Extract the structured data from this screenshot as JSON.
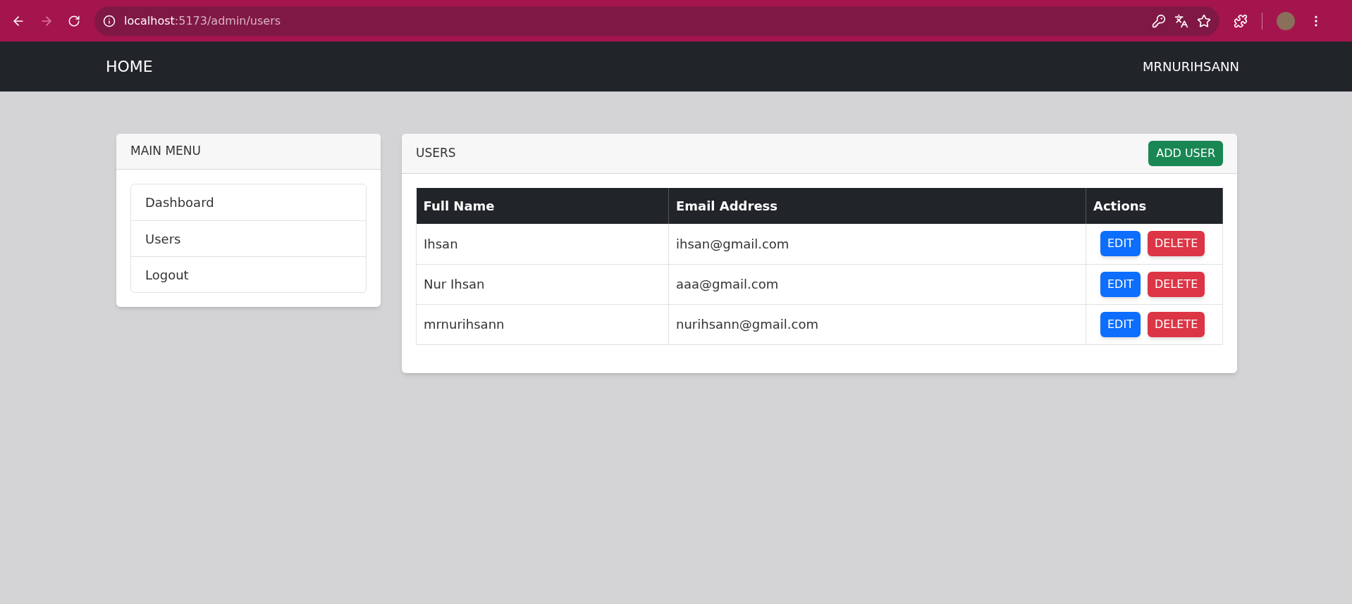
{
  "browser": {
    "url_host": "localhost",
    "url_path": ":5173/admin/users"
  },
  "navbar": {
    "brand": "HOME",
    "user": "MRNURIHSANN"
  },
  "menu": {
    "title": "MAIN MENU",
    "items": [
      {
        "label": "Dashboard"
      },
      {
        "label": "Users"
      },
      {
        "label": "Logout"
      }
    ]
  },
  "users": {
    "title": "USERS",
    "add_button": "ADD USER",
    "table": {
      "columns": [
        "Full Name",
        "Email Address",
        "Actions"
      ],
      "rows": [
        {
          "name": "Ihsan",
          "email": "ihsan@gmail.com",
          "actions": [
            "EDIT",
            "DELETE"
          ]
        },
        {
          "name": "Nur Ihsan",
          "email": "aaa@gmail.com",
          "actions": [
            "EDIT",
            "DELETE"
          ]
        },
        {
          "name": "mrnurihsann",
          "email": "nurihsann@gmail.com",
          "actions": [
            "EDIT",
            "DELETE"
          ]
        }
      ]
    }
  }
}
